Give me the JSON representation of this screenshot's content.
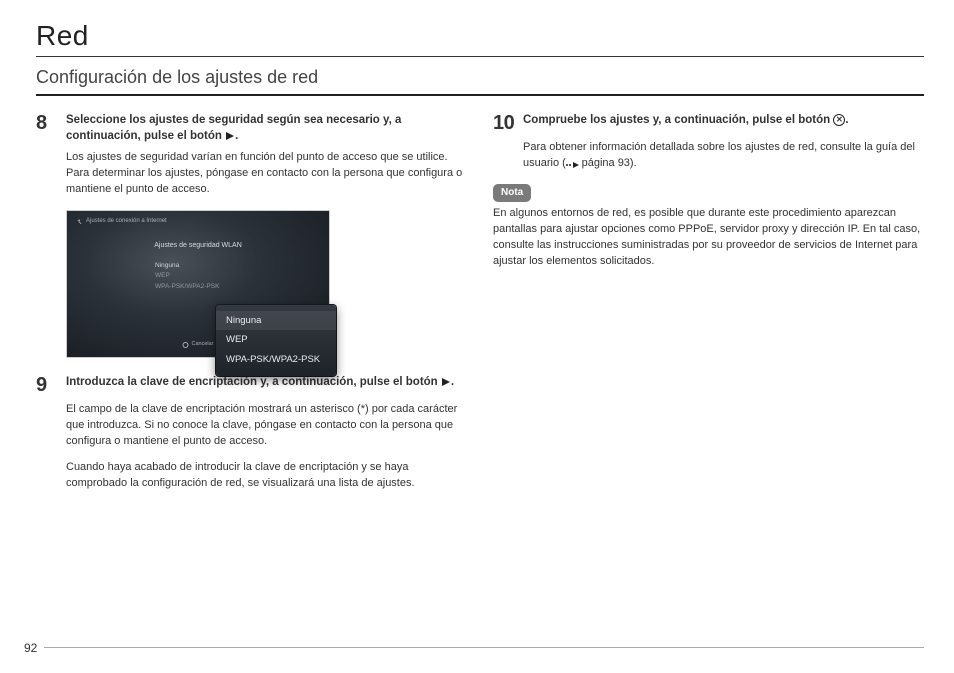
{
  "page": {
    "title": "Red",
    "section": "Configuración de los ajustes de red",
    "number": "92"
  },
  "left": {
    "step8": {
      "num": "8",
      "head": "Seleccione los ajustes de seguridad según sea necesario y, a continuación, pulse el botón ",
      "tail": ".",
      "body": "Los ajustes de seguridad varían en función del punto de acceso que se utilice. Para determinar los ajustes, póngase en contacto con la persona que configura o mantiene el punto de acceso."
    },
    "shot": {
      "breadcrumb": "Ajustes de conexión a Internet",
      "header": "Ajustes de seguridad WLAN",
      "f1": "Ninguna",
      "f2": "WEP",
      "f3": "WPA-PSK/WPA2-PSK",
      "hint": "Cancelar"
    },
    "popup": {
      "opt1": "Ninguna",
      "opt2": "WEP",
      "opt3": "WPA-PSK/WPA2-PSK"
    },
    "step9": {
      "num": "9",
      "head": "Introduzca la clave de encriptación y, a continuación, pulse el botón ",
      "tail": ".",
      "body1": "El campo de la clave de encriptación mostrará un asterisco (*) por cada carácter que introduzca. Si no conoce la clave, póngase en contacto con la persona que configura o mantiene el punto de acceso.",
      "body2": "Cuando haya acabado de introducir la clave de encriptación y se haya comprobado la configuración de red, se visualizará una lista de ajustes."
    }
  },
  "right": {
    "step10": {
      "num": "10",
      "head": "Compruebe los ajustes y, a continuación, pulse el botón ",
      "tail": ".",
      "body_a": "Para obtener información detallada sobre los ajustes de red, consulte la guía del usuario (",
      "body_b": " página 93)."
    },
    "note": {
      "label": "Nota",
      "text": "En algunos entornos de red, es posible que durante este procedimiento aparezcan pantallas para ajustar opciones como PPPoE, servidor proxy y dirección IP. En tal caso, consulte las instrucciones suministradas por su proveedor de servicios de Internet para ajustar los elementos solicitados."
    }
  }
}
